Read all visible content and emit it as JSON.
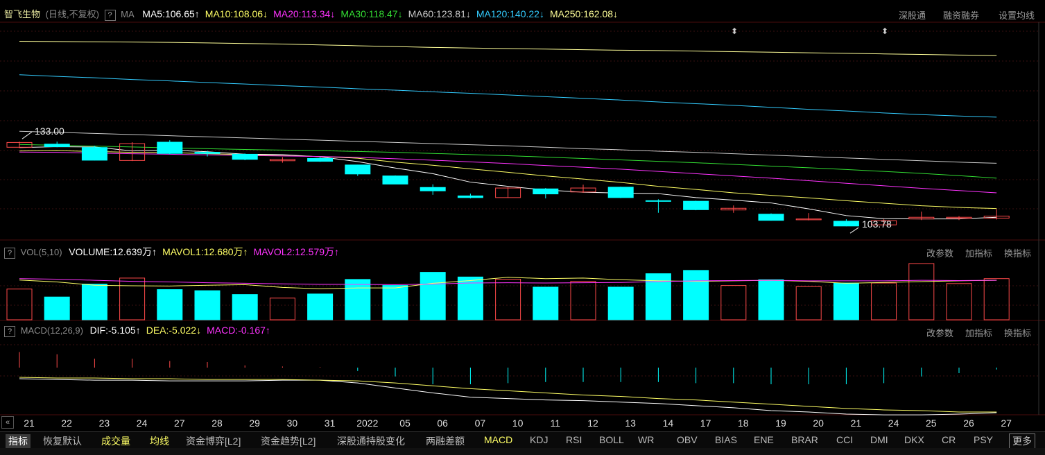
{
  "header": {
    "stock_name": "智飞生物",
    "period": "(日线,不复权)",
    "help": "?",
    "indicator": "MA",
    "right_links": [
      "深股通",
      "融资融券",
      "设置均线"
    ]
  },
  "ma_legend": [
    {
      "label": "MA5:106.65",
      "arrow": "↑",
      "color": "#ffffff"
    },
    {
      "label": "MA10:108.06",
      "arrow": "↓",
      "color": "#ffff66"
    },
    {
      "label": "MA20:113.34",
      "arrow": "↓",
      "color": "#ff33ff"
    },
    {
      "label": "MA30:118.47",
      "arrow": "↓",
      "color": "#33dd33"
    },
    {
      "label": "MA60:123.81",
      "arrow": "↓",
      "color": "#cccccc"
    },
    {
      "label": "MA120:140.22",
      "arrow": "↓",
      "color": "#33ccff"
    },
    {
      "label": "MA250:162.08",
      "arrow": "↓",
      "color": "#ffff99"
    }
  ],
  "vol_header": {
    "name": "VOL(5,10)",
    "items": [
      {
        "label": "VOLUME:12.639万",
        "arrow": "↑",
        "color": "#ffffff"
      },
      {
        "label": "MAVOL1:12.680万",
        "arrow": "↑",
        "color": "#ffff66"
      },
      {
        "label": "MAVOL2:12.579万",
        "arrow": "↑",
        "color": "#ff33ff"
      }
    ],
    "buttons": [
      "改参数",
      "加指标",
      "换指标"
    ]
  },
  "macd_header": {
    "name": "MACD(12,26,9)",
    "items": [
      {
        "label": "DIF:-5.105",
        "arrow": "↑",
        "color": "#ffffff"
      },
      {
        "label": "DEA:-5.022",
        "arrow": "↓",
        "color": "#ffff66"
      },
      {
        "label": "MACD:-0.167",
        "arrow": "↑",
        "color": "#ff33ff"
      }
    ],
    "buttons": [
      "改参数",
      "加指标",
      "换指标"
    ]
  },
  "annotations": {
    "high": "133.00",
    "low": "103.78"
  },
  "chart_data": {
    "type": "candlestick",
    "x": [
      "21",
      "22",
      "23",
      "24",
      "27",
      "28",
      "29",
      "30",
      "31",
      "2022",
      "05",
      "06",
      "07",
      "10",
      "11",
      "12",
      "13",
      "14",
      "17",
      "18",
      "19",
      "20",
      "21",
      "24",
      "25",
      "26",
      "27"
    ],
    "candles": [
      {
        "o": 129.5,
        "c": 131.2,
        "h": 131.5,
        "l": 129.2,
        "up": true
      },
      {
        "o": 130.6,
        "c": 129.7,
        "h": 131.5,
        "l": 129.5,
        "up": false
      },
      {
        "o": 129.4,
        "c": 124.9,
        "h": 130.0,
        "l": 124.8,
        "up": false
      },
      {
        "o": 124.8,
        "c": 130.8,
        "h": 131.3,
        "l": 124.6,
        "up": true
      },
      {
        "o": 131.3,
        "c": 127.3,
        "h": 132.0,
        "l": 127.0,
        "up": false
      },
      {
        "o": 127.7,
        "c": 127.3,
        "h": 128.3,
        "l": 126.2,
        "up": false
      },
      {
        "o": 127.0,
        "c": 125.2,
        "h": 127.3,
        "l": 124.9,
        "up": false
      },
      {
        "o": 124.7,
        "c": 125.2,
        "h": 126.0,
        "l": 124.0,
        "up": true
      },
      {
        "o": 125.5,
        "c": 124.5,
        "h": 126.1,
        "l": 124.3,
        "up": false
      },
      {
        "o": 123.2,
        "c": 120.0,
        "h": 123.3,
        "l": 119.3,
        "up": false
      },
      {
        "o": 119.3,
        "c": 116.4,
        "h": 119.5,
        "l": 116.4,
        "up": false
      },
      {
        "o": 115.2,
        "c": 114.0,
        "h": 116.3,
        "l": 112.6,
        "up": false
      },
      {
        "o": 112.2,
        "c": 111.6,
        "h": 113.0,
        "l": 111.3,
        "up": false
      },
      {
        "o": 111.6,
        "c": 115.0,
        "h": 115.3,
        "l": 111.5,
        "up": true
      },
      {
        "o": 114.7,
        "c": 112.9,
        "h": 115.0,
        "l": 111.3,
        "up": false
      },
      {
        "o": 113.6,
        "c": 115.0,
        "h": 116.2,
        "l": 113.3,
        "up": true
      },
      {
        "o": 115.3,
        "c": 111.6,
        "h": 115.5,
        "l": 111.4,
        "up": false
      },
      {
        "o": 110.5,
        "c": 110.5,
        "h": 111.0,
        "l": 106.2,
        "up": false
      },
      {
        "o": 110.3,
        "c": 107.3,
        "h": 110.5,
        "l": 107.1,
        "up": false
      },
      {
        "o": 107.2,
        "c": 107.8,
        "h": 108.8,
        "l": 106.2,
        "up": true
      },
      {
        "o": 105.7,
        "c": 103.5,
        "h": 106.0,
        "l": 103.4,
        "up": false
      },
      {
        "o": 103.7,
        "c": 104.0,
        "h": 106.1,
        "l": 103.5,
        "up": true
      },
      {
        "o": 103.2,
        "c": 101.5,
        "h": 103.9,
        "l": 101.4,
        "up": false
      },
      {
        "o": 101.9,
        "c": 103.4,
        "h": 103.9,
        "l": 101.8,
        "up": true
      },
      {
        "o": 104.0,
        "c": 104.6,
        "h": 106.6,
        "l": 103.6,
        "up": true
      },
      {
        "o": 104.2,
        "c": 104.6,
        "h": 105.0,
        "l": 103.6,
        "up": true
      },
      {
        "o": 104.3,
        "c": 105.0,
        "h": 107.5,
        "l": 103.8,
        "up": true
      }
    ],
    "ma_lines": [
      {
        "name": "MA5",
        "color": "#ffffff",
        "values": [
          129.4,
          129.7,
          129.6,
          128.2,
          128.5,
          127.9,
          127.0,
          126.9,
          126.1,
          124.4,
          122.1,
          120.1,
          117.1,
          115.6,
          114.3,
          113.5,
          113.2,
          113.0,
          111.6,
          110.7,
          109.7,
          107.6,
          105.2,
          104.1,
          104.0,
          104.0,
          104.6
        ]
      },
      {
        "name": "MA10",
        "color": "#ffff66",
        "values": [
          128.2,
          128.3,
          128.0,
          127.7,
          127.6,
          127.2,
          126.9,
          126.5,
          126.2,
          125.6,
          124.2,
          123.1,
          121.8,
          120.6,
          119.3,
          118.2,
          117.0,
          115.6,
          114.5,
          113.3,
          112.4,
          111.5,
          110.5,
          109.6,
          108.7,
          108.1,
          107.7
        ]
      },
      {
        "name": "MA20",
        "color": "#ff33ff",
        "values": [
          127.8,
          127.7,
          127.4,
          127.2,
          127.0,
          126.8,
          126.6,
          126.4,
          126.2,
          125.9,
          125.4,
          124.9,
          124.3,
          123.7,
          123.0,
          122.4,
          121.7,
          120.9,
          120.1,
          119.3,
          118.5,
          117.6,
          116.7,
          115.8,
          114.9,
          114.1,
          113.3
        ]
      },
      {
        "name": "MA30",
        "color": "#33dd33",
        "values": [
          130.5,
          130.2,
          129.9,
          129.6,
          129.3,
          129.0,
          128.7,
          128.5,
          128.3,
          128.0,
          127.7,
          127.3,
          126.9,
          126.5,
          126.0,
          125.5,
          125.0,
          124.5,
          124.0,
          123.4,
          122.8,
          122.2,
          121.6,
          120.9,
          120.2,
          119.4,
          118.5
        ]
      },
      {
        "name": "MA60",
        "color": "#cccccc",
        "values": [
          135.2,
          134.8,
          134.4,
          134.0,
          133.6,
          133.2,
          132.8,
          132.4,
          132.0,
          131.6,
          131.2,
          130.8,
          130.4,
          130.0,
          129.5,
          129.0,
          128.6,
          128.1,
          127.7,
          127.2,
          126.7,
          126.2,
          125.7,
          125.2,
          124.7,
          124.2,
          123.8
        ]
      },
      {
        "name": "MA120",
        "color": "#33ccff",
        "values": [
          155.3,
          154.7,
          154.2,
          153.6,
          153.1,
          152.5,
          152.0,
          151.4,
          150.9,
          150.3,
          149.8,
          149.2,
          148.7,
          148.1,
          147.5,
          146.9,
          146.3,
          145.6,
          145.0,
          144.4,
          143.7,
          143.0,
          142.4,
          141.7,
          141.1,
          140.6,
          140.2
        ]
      },
      {
        "name": "MA250",
        "color": "#ffff99",
        "values": [
          167.2,
          167.1,
          167.0,
          166.9,
          166.8,
          166.6,
          166.4,
          166.2,
          165.9,
          165.6,
          165.3,
          165.0,
          164.8,
          164.6,
          164.4,
          164.2,
          164.0,
          163.9,
          163.7,
          163.5,
          163.3,
          163.1,
          162.9,
          162.7,
          162.5,
          162.3,
          162.1
        ]
      }
    ],
    "volume": {
      "unit": "万",
      "values": [
        11.2,
        8.3,
        13.0,
        15.2,
        11.0,
        10.6,
        9.2,
        7.9,
        9.4,
        14.7,
        12.5,
        17.3,
        15.6,
        14.8,
        11.9,
        14.0,
        11.9,
        16.8,
        18.0,
        12.5,
        14.6,
        12.1,
        13.4,
        13.4,
        20.5,
        13.2,
        15.0
      ],
      "mavol1": [
        14.5,
        13.8,
        12.6,
        12.4,
        12.3,
        12.6,
        12.8,
        11.8,
        11.3,
        11.6,
        11.6,
        13.3,
        14.3,
        15.5,
        15.0,
        15.2,
        14.6,
        14.2,
        14.0,
        14.2,
        14.4,
        14.0,
        13.3,
        13.6,
        13.9,
        14.2,
        14.4
      ],
      "mavol2": [
        15.0,
        14.8,
        14.4,
        14.0,
        13.8,
        13.5,
        13.3,
        13.1,
        12.9,
        12.9,
        12.8,
        13.0,
        13.4,
        13.5,
        13.4,
        13.5,
        13.6,
        13.9,
        14.2,
        14.3,
        14.4,
        14.2,
        14.2,
        14.2,
        14.4,
        14.3,
        14.4
      ],
      "up": [
        true,
        false,
        false,
        true,
        false,
        false,
        false,
        true,
        false,
        false,
        false,
        false,
        false,
        true,
        false,
        true,
        false,
        false,
        false,
        true,
        false,
        true,
        false,
        true,
        true,
        true,
        true
      ]
    },
    "macd": {
      "dif": [
        -0.3,
        -0.4,
        -0.5,
        -0.5,
        -0.6,
        -0.6,
        -0.6,
        -0.5,
        -0.5,
        -0.9,
        -1.6,
        -2.3,
        -2.9,
        -3.1,
        -3.3,
        -3.4,
        -3.6,
        -3.8,
        -4.1,
        -4.4,
        -4.8,
        -5.0,
        -5.3,
        -5.4,
        -5.4,
        -5.3,
        -5.1
      ],
      "dea": [
        -0.1,
        -0.2,
        -0.2,
        -0.3,
        -0.3,
        -0.4,
        -0.4,
        -0.4,
        -0.5,
        -0.6,
        -0.9,
        -1.3,
        -1.7,
        -2.0,
        -2.3,
        -2.6,
        -2.8,
        -3.1,
        -3.3,
        -3.6,
        -3.9,
        -4.2,
        -4.5,
        -4.7,
        -4.8,
        -5.0,
        -5.0
      ],
      "hist": [
        1.4,
        1.2,
        0.8,
        0.8,
        0.6,
        0.5,
        0.2,
        0.1,
        0.05,
        -0.3,
        -0.8,
        -1.5,
        -1.5,
        -1.4,
        -1.3,
        -1.3,
        -1.3,
        -1.3,
        -1.4,
        -1.4,
        -1.5,
        -1.5,
        -1.5,
        -1.4,
        -0.8,
        -0.5,
        -0.17
      ],
      "hist_range": [
        -2.0,
        2.0
      ]
    },
    "price_range": [
      98,
      172
    ]
  },
  "tabs": [
    "指标",
    "恢复默认",
    "成交量",
    "均线",
    "资金博弈[L2]",
    "资金趋势[L2]",
    "深股通持股变化",
    "两融差额",
    "MACD",
    "KDJ",
    "RSI",
    "BOLL",
    "WR",
    "OBV",
    "BIAS",
    "ENE",
    "BRAR",
    "CCI",
    "DMI",
    "DKX",
    "CR",
    "PSY"
  ],
  "more": "更多",
  "scroll_left": "«"
}
